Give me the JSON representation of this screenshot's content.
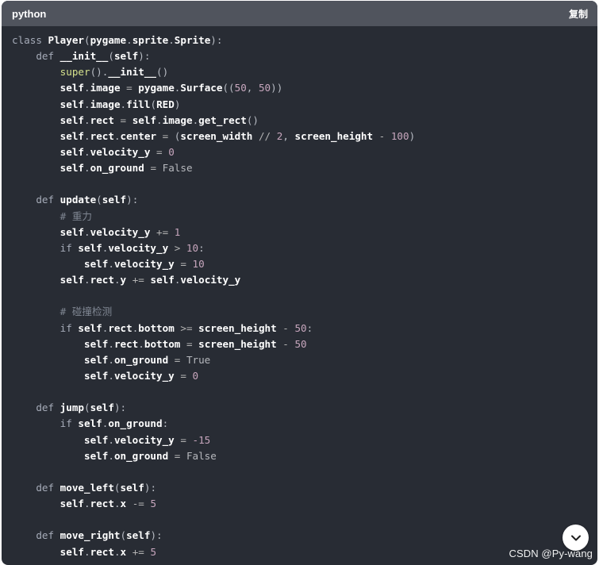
{
  "code_block": {
    "language_label": "python",
    "copy_label": "复制",
    "lines": [
      [
        {
          "t": "class ",
          "c": "kw"
        },
        {
          "t": "Player",
          "c": "name"
        },
        {
          "t": "(",
          "c": "punct"
        },
        {
          "t": "pygame",
          "c": "bold"
        },
        {
          "t": ".",
          "c": "punct"
        },
        {
          "t": "sprite",
          "c": "bold"
        },
        {
          "t": ".",
          "c": "punct"
        },
        {
          "t": "Sprite",
          "c": "bold"
        },
        {
          "t": "):",
          "c": "punct"
        }
      ],
      [
        {
          "t": "    def ",
          "c": "kw"
        },
        {
          "t": "__init__",
          "c": "name"
        },
        {
          "t": "(",
          "c": "punct"
        },
        {
          "t": "self",
          "c": "self"
        },
        {
          "t": "):",
          "c": "punct"
        }
      ],
      [
        {
          "t": "        ",
          "c": "default"
        },
        {
          "t": "super",
          "c": "super"
        },
        {
          "t": "().",
          "c": "punct"
        },
        {
          "t": "__init__",
          "c": "bold"
        },
        {
          "t": "()",
          "c": "punct"
        }
      ],
      [
        {
          "t": "        ",
          "c": "default"
        },
        {
          "t": "self",
          "c": "self"
        },
        {
          "t": ".",
          "c": "punct"
        },
        {
          "t": "image",
          "c": "bold"
        },
        {
          "t": " = ",
          "c": "op"
        },
        {
          "t": "pygame",
          "c": "bold"
        },
        {
          "t": ".",
          "c": "punct"
        },
        {
          "t": "Surface",
          "c": "bold"
        },
        {
          "t": "((",
          "c": "punct"
        },
        {
          "t": "50",
          "c": "num"
        },
        {
          "t": ", ",
          "c": "punct"
        },
        {
          "t": "50",
          "c": "num"
        },
        {
          "t": "))",
          "c": "punct"
        }
      ],
      [
        {
          "t": "        ",
          "c": "default"
        },
        {
          "t": "self",
          "c": "self"
        },
        {
          "t": ".",
          "c": "punct"
        },
        {
          "t": "image",
          "c": "bold"
        },
        {
          "t": ".",
          "c": "punct"
        },
        {
          "t": "fill",
          "c": "bold"
        },
        {
          "t": "(",
          "c": "punct"
        },
        {
          "t": "RED",
          "c": "bold"
        },
        {
          "t": ")",
          "c": "punct"
        }
      ],
      [
        {
          "t": "        ",
          "c": "default"
        },
        {
          "t": "self",
          "c": "self"
        },
        {
          "t": ".",
          "c": "punct"
        },
        {
          "t": "rect",
          "c": "bold"
        },
        {
          "t": " = ",
          "c": "op"
        },
        {
          "t": "self",
          "c": "self"
        },
        {
          "t": ".",
          "c": "punct"
        },
        {
          "t": "image",
          "c": "bold"
        },
        {
          "t": ".",
          "c": "punct"
        },
        {
          "t": "get_rect",
          "c": "bold"
        },
        {
          "t": "()",
          "c": "punct"
        }
      ],
      [
        {
          "t": "        ",
          "c": "default"
        },
        {
          "t": "self",
          "c": "self"
        },
        {
          "t": ".",
          "c": "punct"
        },
        {
          "t": "rect",
          "c": "bold"
        },
        {
          "t": ".",
          "c": "punct"
        },
        {
          "t": "center",
          "c": "bold"
        },
        {
          "t": " = ",
          "c": "op"
        },
        {
          "t": "(",
          "c": "punct"
        },
        {
          "t": "screen_width",
          "c": "bold"
        },
        {
          "t": " // ",
          "c": "op"
        },
        {
          "t": "2",
          "c": "num"
        },
        {
          "t": ", ",
          "c": "punct"
        },
        {
          "t": "screen_height",
          "c": "bold"
        },
        {
          "t": " - ",
          "c": "op"
        },
        {
          "t": "100",
          "c": "num"
        },
        {
          "t": ")",
          "c": "punct"
        }
      ],
      [
        {
          "t": "        ",
          "c": "default"
        },
        {
          "t": "self",
          "c": "self"
        },
        {
          "t": ".",
          "c": "punct"
        },
        {
          "t": "velocity_y",
          "c": "bold"
        },
        {
          "t": " = ",
          "c": "op"
        },
        {
          "t": "0",
          "c": "num"
        }
      ],
      [
        {
          "t": "        ",
          "c": "default"
        },
        {
          "t": "self",
          "c": "self"
        },
        {
          "t": ".",
          "c": "punct"
        },
        {
          "t": "on_ground",
          "c": "bold"
        },
        {
          "t": " = ",
          "c": "op"
        },
        {
          "t": "False",
          "c": "const"
        }
      ],
      [],
      [
        {
          "t": "    def ",
          "c": "kw"
        },
        {
          "t": "update",
          "c": "name"
        },
        {
          "t": "(",
          "c": "punct"
        },
        {
          "t": "self",
          "c": "self"
        },
        {
          "t": "):",
          "c": "punct"
        }
      ],
      [
        {
          "t": "        # 重力",
          "c": "comment"
        }
      ],
      [
        {
          "t": "        ",
          "c": "default"
        },
        {
          "t": "self",
          "c": "self"
        },
        {
          "t": ".",
          "c": "punct"
        },
        {
          "t": "velocity_y",
          "c": "bold"
        },
        {
          "t": " += ",
          "c": "op"
        },
        {
          "t": "1",
          "c": "num"
        }
      ],
      [
        {
          "t": "        if ",
          "c": "kw"
        },
        {
          "t": "self",
          "c": "self"
        },
        {
          "t": ".",
          "c": "punct"
        },
        {
          "t": "velocity_y",
          "c": "bold"
        },
        {
          "t": " > ",
          "c": "op"
        },
        {
          "t": "10",
          "c": "num"
        },
        {
          "t": ":",
          "c": "punct"
        }
      ],
      [
        {
          "t": "            ",
          "c": "default"
        },
        {
          "t": "self",
          "c": "self"
        },
        {
          "t": ".",
          "c": "punct"
        },
        {
          "t": "velocity_y",
          "c": "bold"
        },
        {
          "t": " = ",
          "c": "op"
        },
        {
          "t": "10",
          "c": "num"
        }
      ],
      [
        {
          "t": "        ",
          "c": "default"
        },
        {
          "t": "self",
          "c": "self"
        },
        {
          "t": ".",
          "c": "punct"
        },
        {
          "t": "rect",
          "c": "bold"
        },
        {
          "t": ".",
          "c": "punct"
        },
        {
          "t": "y",
          "c": "bold"
        },
        {
          "t": " += ",
          "c": "op"
        },
        {
          "t": "self",
          "c": "self"
        },
        {
          "t": ".",
          "c": "punct"
        },
        {
          "t": "velocity_y",
          "c": "bold"
        }
      ],
      [],
      [
        {
          "t": "        # 碰撞检测",
          "c": "comment"
        }
      ],
      [
        {
          "t": "        if ",
          "c": "kw"
        },
        {
          "t": "self",
          "c": "self"
        },
        {
          "t": ".",
          "c": "punct"
        },
        {
          "t": "rect",
          "c": "bold"
        },
        {
          "t": ".",
          "c": "punct"
        },
        {
          "t": "bottom",
          "c": "bold"
        },
        {
          "t": " >= ",
          "c": "op"
        },
        {
          "t": "screen_height",
          "c": "bold"
        },
        {
          "t": " - ",
          "c": "op"
        },
        {
          "t": "50",
          "c": "num"
        },
        {
          "t": ":",
          "c": "punct"
        }
      ],
      [
        {
          "t": "            ",
          "c": "default"
        },
        {
          "t": "self",
          "c": "self"
        },
        {
          "t": ".",
          "c": "punct"
        },
        {
          "t": "rect",
          "c": "bold"
        },
        {
          "t": ".",
          "c": "punct"
        },
        {
          "t": "bottom",
          "c": "bold"
        },
        {
          "t": " = ",
          "c": "op"
        },
        {
          "t": "screen_height",
          "c": "bold"
        },
        {
          "t": " - ",
          "c": "op"
        },
        {
          "t": "50",
          "c": "num"
        }
      ],
      [
        {
          "t": "            ",
          "c": "default"
        },
        {
          "t": "self",
          "c": "self"
        },
        {
          "t": ".",
          "c": "punct"
        },
        {
          "t": "on_ground",
          "c": "bold"
        },
        {
          "t": " = ",
          "c": "op"
        },
        {
          "t": "True",
          "c": "const"
        }
      ],
      [
        {
          "t": "            ",
          "c": "default"
        },
        {
          "t": "self",
          "c": "self"
        },
        {
          "t": ".",
          "c": "punct"
        },
        {
          "t": "velocity_y",
          "c": "bold"
        },
        {
          "t": " = ",
          "c": "op"
        },
        {
          "t": "0",
          "c": "num"
        }
      ],
      [],
      [
        {
          "t": "    def ",
          "c": "kw"
        },
        {
          "t": "jump",
          "c": "name"
        },
        {
          "t": "(",
          "c": "punct"
        },
        {
          "t": "self",
          "c": "self"
        },
        {
          "t": "):",
          "c": "punct"
        }
      ],
      [
        {
          "t": "        if ",
          "c": "kw"
        },
        {
          "t": "self",
          "c": "self"
        },
        {
          "t": ".",
          "c": "punct"
        },
        {
          "t": "on_ground",
          "c": "bold"
        },
        {
          "t": ":",
          "c": "punct"
        }
      ],
      [
        {
          "t": "            ",
          "c": "default"
        },
        {
          "t": "self",
          "c": "self"
        },
        {
          "t": ".",
          "c": "punct"
        },
        {
          "t": "velocity_y",
          "c": "bold"
        },
        {
          "t": " = ",
          "c": "op"
        },
        {
          "t": "-15",
          "c": "num"
        }
      ],
      [
        {
          "t": "            ",
          "c": "default"
        },
        {
          "t": "self",
          "c": "self"
        },
        {
          "t": ".",
          "c": "punct"
        },
        {
          "t": "on_ground",
          "c": "bold"
        },
        {
          "t": " = ",
          "c": "op"
        },
        {
          "t": "False",
          "c": "const"
        }
      ],
      [],
      [
        {
          "t": "    def ",
          "c": "kw"
        },
        {
          "t": "move_left",
          "c": "name"
        },
        {
          "t": "(",
          "c": "punct"
        },
        {
          "t": "self",
          "c": "self"
        },
        {
          "t": "):",
          "c": "punct"
        }
      ],
      [
        {
          "t": "        ",
          "c": "default"
        },
        {
          "t": "self",
          "c": "self"
        },
        {
          "t": ".",
          "c": "punct"
        },
        {
          "t": "rect",
          "c": "bold"
        },
        {
          "t": ".",
          "c": "punct"
        },
        {
          "t": "x",
          "c": "bold"
        },
        {
          "t": " -= ",
          "c": "op"
        },
        {
          "t": "5",
          "c": "num"
        }
      ],
      [],
      [
        {
          "t": "    def ",
          "c": "kw"
        },
        {
          "t": "move_right",
          "c": "name"
        },
        {
          "t": "(",
          "c": "punct"
        },
        {
          "t": "self",
          "c": "self"
        },
        {
          "t": "):",
          "c": "punct"
        }
      ],
      [
        {
          "t": "        ",
          "c": "default"
        },
        {
          "t": "self",
          "c": "self"
        },
        {
          "t": ".",
          "c": "punct"
        },
        {
          "t": "rect",
          "c": "bold"
        },
        {
          "t": ".",
          "c": "punct"
        },
        {
          "t": "x",
          "c": "bold"
        },
        {
          "t": " += ",
          "c": "op"
        },
        {
          "t": "5",
          "c": "num"
        }
      ]
    ]
  },
  "scroll_button": {
    "icon": "chevron-down-icon"
  },
  "watermark": {
    "text": "CSDN @Py-wang"
  },
  "colors": {
    "code_background": "#282c34",
    "header_background": "#50545d",
    "number": "#c8a7be",
    "builtin": "#d6e28d",
    "comment": "#7f8692"
  }
}
